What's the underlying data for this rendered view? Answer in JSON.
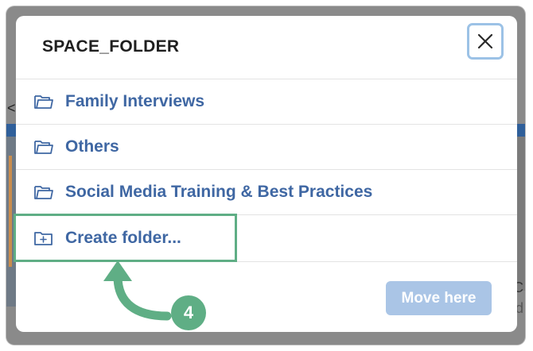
{
  "dialog": {
    "title": "SPACE_FOLDER",
    "close_icon": "close-icon"
  },
  "folders": [
    {
      "label": "Family Interviews",
      "icon": "folder-icon"
    },
    {
      "label": "Others",
      "icon": "folder-icon"
    },
    {
      "label": "Social Media Training & Best Practices",
      "icon": "folder-icon"
    }
  ],
  "create_folder": {
    "label": "Create folder...",
    "icon": "folder-plus-icon"
  },
  "footer": {
    "move_label": "Move here"
  },
  "annotation": {
    "step_number": "4",
    "arrow_icon": "curved-arrow-icon"
  },
  "background": {
    "left_glyph": "<",
    "right_glyph_1": "C",
    "right_glyph_2": "d"
  },
  "colors": {
    "link": "#3f67a3",
    "highlight": "#5fae85",
    "button_disabled": "#aac5e6",
    "close_border": "#9cc2e6"
  }
}
